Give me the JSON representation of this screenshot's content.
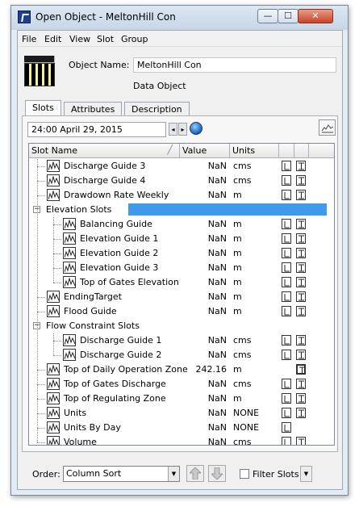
{
  "window": {
    "title": "Open Object - MeltonHill Con",
    "controls": {
      "minimize": "—",
      "maximize": "☐",
      "close": "✕"
    }
  },
  "menu": [
    "File",
    "Edit",
    "View",
    "Slot",
    "Group"
  ],
  "object": {
    "name_label": "Object Name:",
    "name": "MeltonHill Con",
    "type": "Data Object",
    "icon": "data-object-icon"
  },
  "tabs": [
    {
      "label": "Slots",
      "active": true
    },
    {
      "label": "Attributes",
      "active": false
    },
    {
      "label": "Description",
      "active": false
    }
  ],
  "timestep": {
    "value": "24:00 April 29, 2015",
    "prev": "◂",
    "next": "▸"
  },
  "table": {
    "headers": [
      "Slot Name",
      "Value",
      "Units"
    ],
    "rows": [
      {
        "kind": "slot",
        "level": 1,
        "name": "Discharge Guide 3",
        "value": "NaN",
        "units": "cms",
        "flags": [
          true,
          true
        ]
      },
      {
        "kind": "slot",
        "level": 1,
        "name": "Discharge Guide 4",
        "value": "NaN",
        "units": "cms",
        "flags": [
          true,
          true
        ]
      },
      {
        "kind": "slot",
        "level": 1,
        "name": "Drawdown Rate Weekly",
        "value": "NaN",
        "units": "m",
        "flags": [
          true,
          true
        ]
      },
      {
        "kind": "group",
        "level": 0,
        "name": "Elevation Slots",
        "selected": true
      },
      {
        "kind": "slot",
        "level": 2,
        "name": "Balancing Guide",
        "value": "NaN",
        "units": "m",
        "flags": [
          true,
          true
        ]
      },
      {
        "kind": "slot",
        "level": 2,
        "name": "Elevation Guide 1",
        "value": "NaN",
        "units": "m",
        "flags": [
          true,
          true
        ]
      },
      {
        "kind": "slot",
        "level": 2,
        "name": "Elevation Guide 2",
        "value": "NaN",
        "units": "m",
        "flags": [
          true,
          true
        ]
      },
      {
        "kind": "slot",
        "level": 2,
        "name": "Elevation Guide 3",
        "value": "NaN",
        "units": "m",
        "flags": [
          true,
          true
        ]
      },
      {
        "kind": "slot",
        "level": 2,
        "name": "Top of Gates Elevation",
        "value": "NaN",
        "units": "m",
        "flags": [
          true,
          true
        ]
      },
      {
        "kind": "slot",
        "level": 1,
        "name": "EndingTarget",
        "value": "NaN",
        "units": "m",
        "flags": [
          true,
          true
        ]
      },
      {
        "kind": "slot",
        "level": 1,
        "name": "Flood Guide",
        "value": "NaN",
        "units": "m",
        "flags": [
          true,
          true
        ]
      },
      {
        "kind": "group",
        "level": 0,
        "name": "Flow Constraint Slots",
        "selected": false
      },
      {
        "kind": "slot",
        "level": 2,
        "name": "Discharge Guide 1",
        "value": "NaN",
        "units": "cms",
        "flags": [
          true,
          true
        ]
      },
      {
        "kind": "slot",
        "level": 2,
        "name": "Discharge Guide 2",
        "value": "NaN",
        "units": "cms",
        "flags": [
          true,
          true
        ]
      },
      {
        "kind": "slot",
        "level": 1,
        "name": "Top of Daily Operation Zone",
        "value": "242.16",
        "units": "m",
        "flags": [
          false,
          true
        ],
        "dark_flag": true
      },
      {
        "kind": "slot",
        "level": 1,
        "name": "Top of Gates Discharge",
        "value": "NaN",
        "units": "cms",
        "flags": [
          true,
          true
        ]
      },
      {
        "kind": "slot",
        "level": 1,
        "name": "Top of Regulating Zone",
        "value": "NaN",
        "units": "m",
        "flags": [
          true,
          true
        ]
      },
      {
        "kind": "slot",
        "level": 1,
        "name": "Units",
        "value": "NaN",
        "units": "NONE",
        "flags": [
          true,
          true
        ]
      },
      {
        "kind": "slot",
        "level": 1,
        "name": "Units By Day",
        "value": "NaN",
        "units": "NONE",
        "flags": [
          true,
          false
        ]
      },
      {
        "kind": "slot",
        "level": 1,
        "name": "Volume",
        "value": "NaN",
        "units": "cms",
        "flags": [
          true,
          true
        ]
      }
    ]
  },
  "footer": {
    "order_label": "Order:",
    "order_value": "Column Sort",
    "filter_label": "Filter Slots"
  }
}
